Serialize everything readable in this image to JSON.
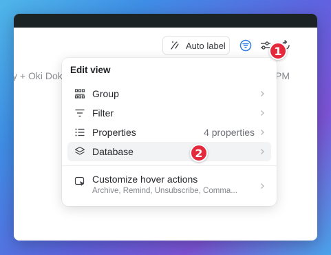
{
  "background": {
    "left_text": "y + Oki Dok",
    "right_text": "PM"
  },
  "toolbar": {
    "auto_label": "Auto label",
    "icons": [
      "sparkle-pen-icon",
      "filter-icon",
      "sliders-icon",
      "refresh-icon"
    ]
  },
  "badges": {
    "one": "1",
    "two": "2"
  },
  "menu": {
    "title": "Edit view",
    "items": [
      {
        "label": "Group",
        "icon": "grid-icon"
      },
      {
        "label": "Filter",
        "icon": "filter-lines-icon"
      },
      {
        "label": "Properties",
        "value": "4 properties",
        "icon": "list-icon"
      },
      {
        "label": "Database",
        "icon": "layers-icon"
      }
    ],
    "hover": {
      "label": "Customize hover actions",
      "sub": "Archive, Remind, Unsubscribe, Comma..."
    }
  },
  "colors": {
    "badge": "#e3293b",
    "accent_blue": "#2f7de1",
    "highlight": "#f2f3f5"
  }
}
